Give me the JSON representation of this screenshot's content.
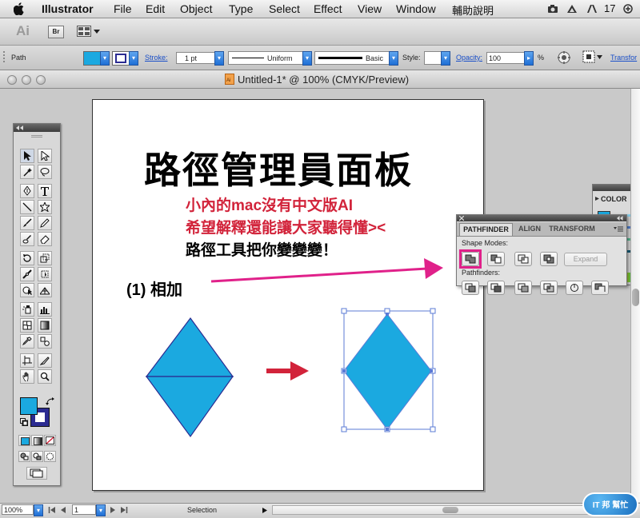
{
  "menubar": {
    "app_name": "Illustrator",
    "items": [
      "File",
      "Edit",
      "Object",
      "Type",
      "Select",
      "Effect",
      "View",
      "Window",
      "輔助說明"
    ],
    "status_num": "17"
  },
  "appbar": {
    "app_logo": "Ai",
    "bridge": "Br"
  },
  "controlbar": {
    "selection_label": "Path",
    "stroke_label": "Stroke:",
    "stroke_weight": "1 pt",
    "profile_label": "Uniform",
    "brush_label": "Basic",
    "style_label": "Style:",
    "opacity_label": "Opacity:",
    "opacity_value": "100",
    "percent": "%",
    "transform_label": "Transfor",
    "fill_color": "#1ba9e0",
    "stroke_color": "#2b2b91"
  },
  "document": {
    "title": "Untitled-1* @ 100% (CMYK/Preview)"
  },
  "artwork": {
    "heading": "路徑管理員面板",
    "note_line1": "小內的mac沒有中文版AI",
    "note_line2": "希望解釋還能讓大家聽得懂><",
    "note_line3": "路徑工具把你變變變！",
    "step_label": "(1) 相加",
    "shape_color": "#1ba9e0",
    "note_color": "#d2233a",
    "arrow_color": "#e0218a"
  },
  "pathfinder": {
    "tabs": [
      "PATHFINDER",
      "ALIGN",
      "TRANSFORM"
    ],
    "shape_modes_label": "Shape Modes:",
    "pathfinders_label": "Pathfinders:",
    "expand_label": "Expand"
  },
  "colorpanel": {
    "tab": "COLOR"
  },
  "statusbar": {
    "zoom": "100%",
    "artboard": "1",
    "tool": "Selection",
    "watermark": "IT 邦 幫忙"
  }
}
